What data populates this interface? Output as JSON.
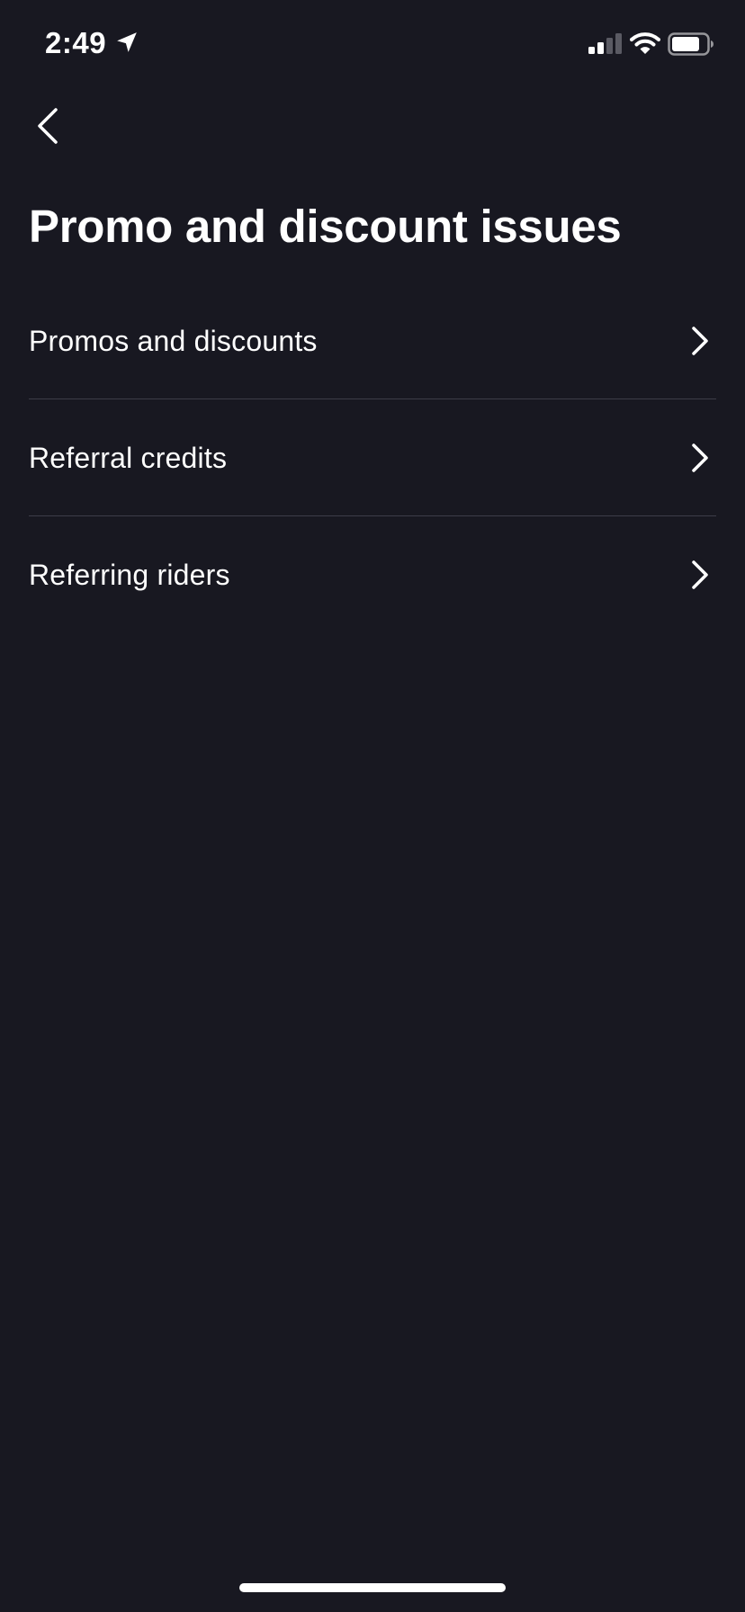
{
  "status_bar": {
    "time": "2:49",
    "icons": [
      "location-arrow-icon",
      "cellular-signal-icon",
      "wifi-icon",
      "battery-icon"
    ]
  },
  "header": {
    "back_icon": "chevron-left-icon",
    "title": "Promo and discount issues"
  },
  "menu": {
    "items": [
      {
        "label": "Promos and discounts",
        "icon": "chevron-right-icon"
      },
      {
        "label": "Referral credits",
        "icon": "chevron-right-icon"
      },
      {
        "label": "Referring riders",
        "icon": "chevron-right-icon"
      }
    ]
  },
  "colors": {
    "background": "#181821",
    "text": "#ffffff",
    "divider": "#3d3d48",
    "signal_inactive": "#5a5a63"
  }
}
